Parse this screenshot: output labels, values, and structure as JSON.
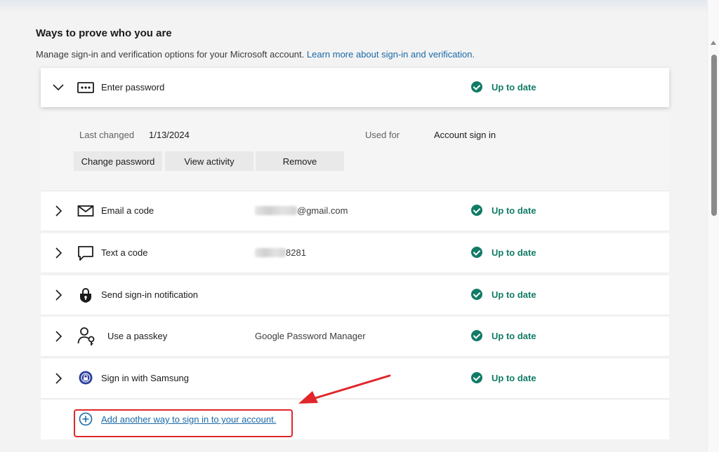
{
  "header": {
    "title": "Ways to prove who you are",
    "description": "Manage sign-in and verification options for your Microsoft account.",
    "learn_more": "Learn more about sign-in and verification."
  },
  "methods": [
    {
      "label": "Enter password",
      "detail": "",
      "status": "Up to date",
      "icon": "password-icon",
      "expanded": true
    },
    {
      "label": "Email a code",
      "detail": "@gmail.com",
      "status": "Up to date",
      "icon": "email-icon"
    },
    {
      "label": "Text a code",
      "detail": "8281",
      "status": "Up to date",
      "icon": "chat-icon"
    },
    {
      "label": "Send sign-in notification",
      "detail": "",
      "status": "Up to date",
      "icon": "lock-shield-icon"
    },
    {
      "label": "Use a passkey",
      "detail": "Google Password Manager",
      "status": "Up to date",
      "icon": "passkey-icon"
    },
    {
      "label": "Sign in with Samsung",
      "detail": "",
      "status": "Up to date",
      "icon": "samsung-icon"
    }
  ],
  "password_panel": {
    "last_changed_label": "Last changed",
    "last_changed_value": "1/13/2024",
    "used_for_label": "Used for",
    "used_for_value": "Account sign in",
    "buttons": [
      "Change password",
      "View activity",
      "Remove"
    ]
  },
  "add_method": {
    "label": "Add another way to sign in to your account."
  },
  "colors": {
    "status_green": "#117b66",
    "link_blue": "#1a6aa8",
    "highlight_red": "#e0262a"
  }
}
